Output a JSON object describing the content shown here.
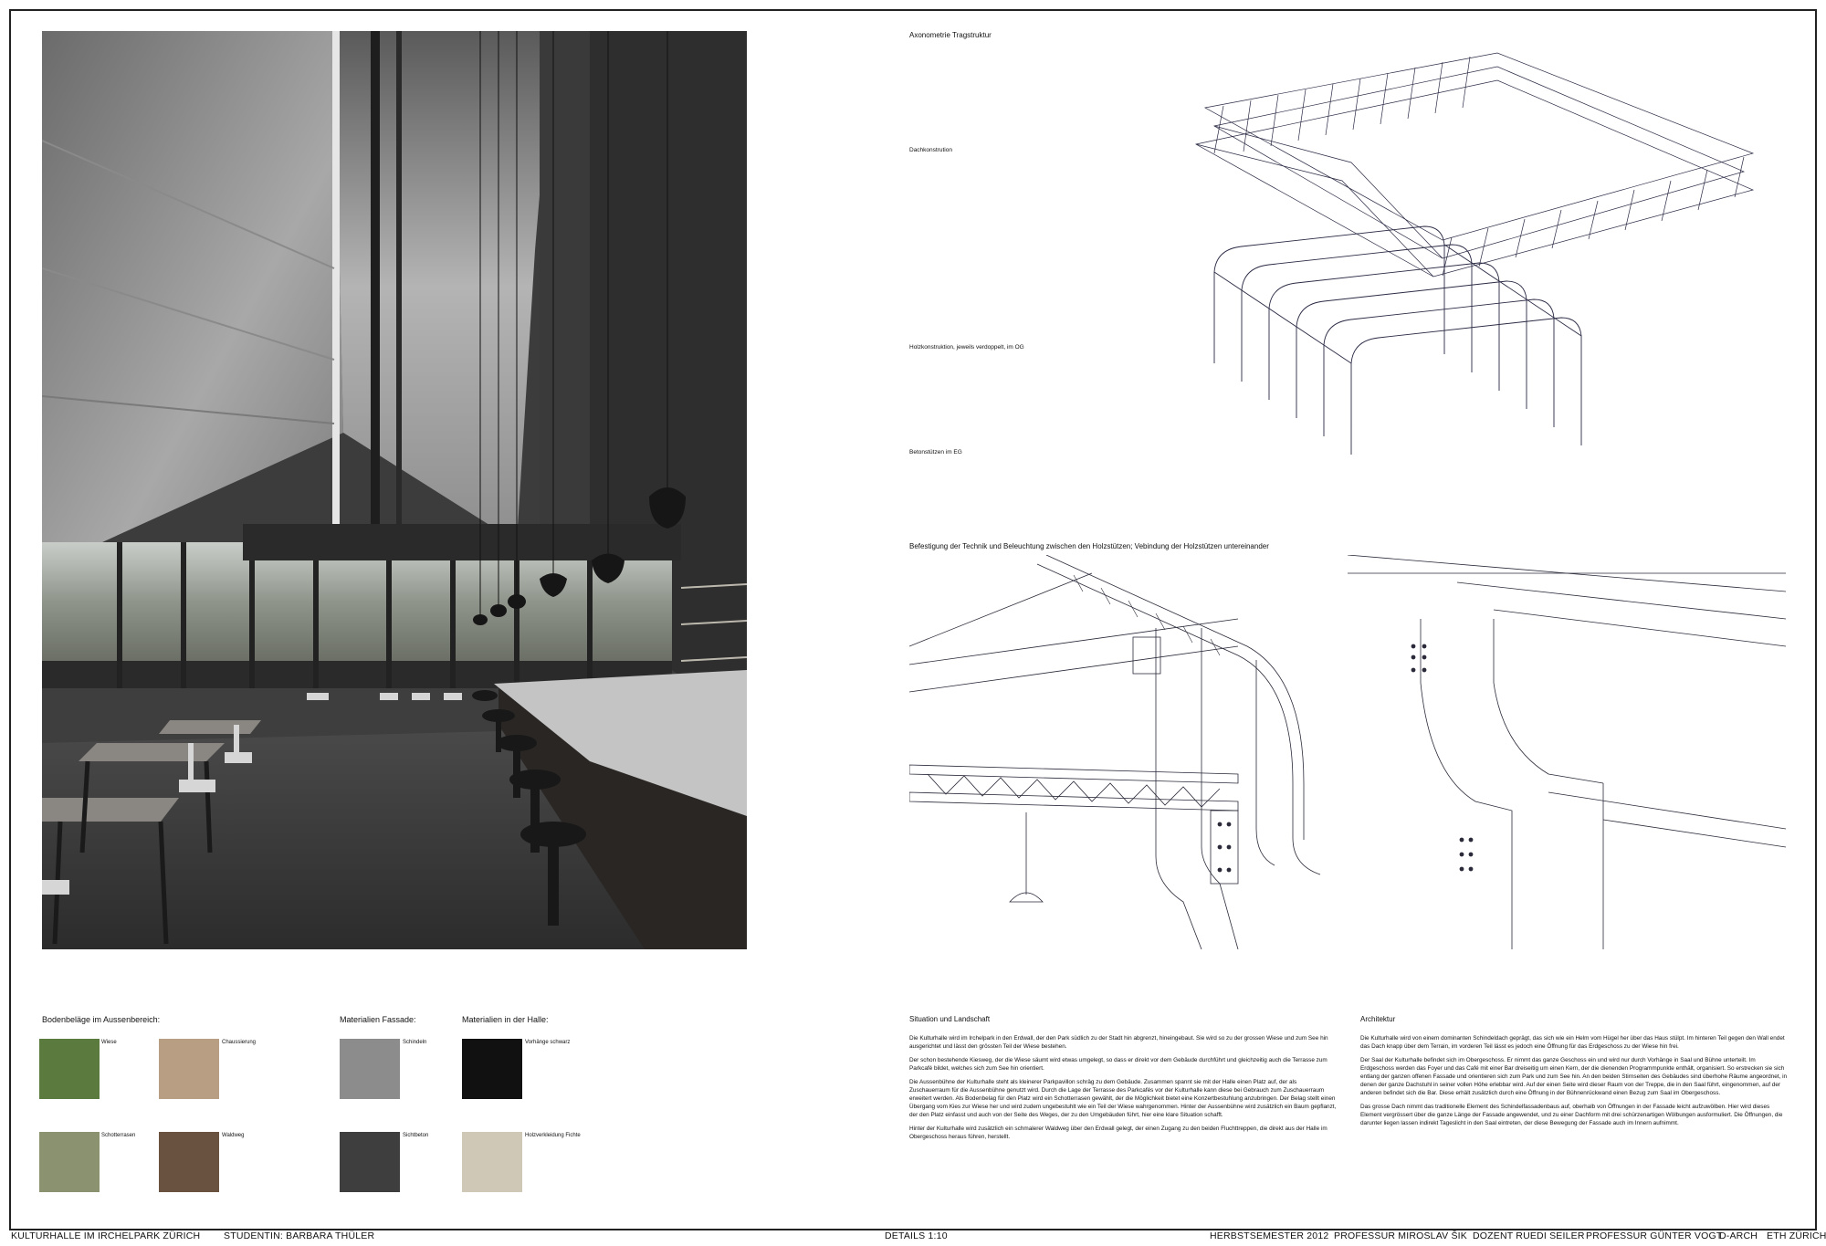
{
  "materials": {
    "outdoor_heading": "Bodenbeläge im Aussenbereich:",
    "facade_heading": "Materialien Fassade:",
    "hall_heading": "Materialien in der Halle:",
    "items": [
      {
        "label": "Wiese",
        "color": "#5a7a3e"
      },
      {
        "label": "Chaussierung",
        "color": "#b89f84"
      },
      {
        "label": "Schotterrasen",
        "color": "#8a9270"
      },
      {
        "label": "Waldweg",
        "color": "#6a5240"
      },
      {
        "label": "Schindeln",
        "color": "#8c8c8c"
      },
      {
        "label": "Sichtbeton",
        "color": "#3e3e3e"
      },
      {
        "label": "Vorhänge schwarz",
        "color": "#111111"
      },
      {
        "label": "Holzverkleidung Fichte",
        "color": "#cfc8b6"
      }
    ]
  },
  "axonometry": {
    "title": "Axonometrie Tragstruktur",
    "layers": [
      "Dachkonstrution",
      "Holzkonstruktion, jeweils verdoppelt, im OG",
      "Betonstützen im EG"
    ]
  },
  "detail": {
    "title": "Befestigung der Technik und Beleuchtung zwischen den Holzstützen; Vebindung der Holzstützen untereinander"
  },
  "situation": {
    "title": "Situation und Landschaft",
    "paragraphs": [
      "Die Kulturhalle wird im Irchelpark in den Erdwall, der den Park südlich zu der Stadt hin abgrenzt, hineingebaut. Sie wird so zu der grossen Wiese und zum See hin ausgerichtet und lässt den grössten Teil der Wiese bestehen.",
      "Der schon bestehende Kiesweg, der die Wiese säumt wird etwas umgelegt, so dass er direkt vor dem Gebäude durchführt und gleichzeitig auch die Terrasse zum Parkcafé bildet, welches sich zum See hin orientiert.",
      "Die Aussenbühne der Kulturhalle steht als kleinerer Parkpavillon schräg zu dem Gebäude. Zusammen spannt sie mit der Halle einen Platz auf, der als Zuschauerraum für die Aussenbühne genutzt wird. Durch die Lage der Terrasse des Parkcafés vor der Kulturhalle kann diese bei Gebrauch zum Zuschauerraum erweitert werden. Als Bodenbelag für den Platz wird ein Schotterrasen gewählt, der die Möglichkeit bietet eine Konzertbestuhlung anzubringen. Der Belag stellt einen Übergang vom Kies zur Wiese her und wird zudem ungebestuhlt wie ein Teil der Wiese wahrgenommen. Hinter der Aussenbühne wird zusätzlich ein Baum gepflanzt, der den Platz einfasst und auch von der Seite des Weges, der zu den Umgebäuden führt, hier eine klare Situation schafft.",
      "Hinter der Kulturhalle wird zusätzlich ein schmalerer Waldweg über den Erdwall gelegt, der einen Zugang zu den beiden Fluchttreppen, die direkt aus der Halle im Obergeschoss heraus führen, herstellt."
    ]
  },
  "architektur": {
    "title": "Architektur",
    "paragraphs": [
      "Die Kulturhalle wird von einem dominanten Schindeldach geprägt, das sich wie ein Helm vom Hügel her über das Haus stülpt. Im hinteren Teil gegen den Wall endet das Dach knapp über dem Terrain, im vorderen Teil lässt es jedoch eine Öffnung für das Erdgeschoss zu der Wiese hin frei.",
      "Der Saal der Kulturhalle befindet sich im Obergeschoss. Er nimmt das ganze Geschoss ein und wird nur durch Vorhänge in Saal und Bühne unterteilt. Im Erdgeschoss werden das Foyer und das Café mit einer Bar dreiseitig um einen Kern, der die dienenden Programmpunkte enthält, organisiert. So erstrecken sie sich entlang der ganzen offenen Fassade und orientieren sich zum Park und zum See hin. An den beiden Stirnseiten des Gebäudes sind überhohe Räume angeordnet, in denen der ganze Dachstuhl in seiner vollen Höhe erlebbar wird. Auf der einen Seite wird dieser Raum von der Treppe, die in den Saal führt, eingenommen, auf der anderen befindet sich die Bar. Diese erhält zusätzlich durch eine Öffnung in der Bühnenrückwand einen Bezug zum Saal im Obergeschoss.",
      "Das grosse Dach nimmt das traditionelle Element des Schindelfassadenbaus auf, oberhalb von Öffnungen in der Fassade leicht aufzuwölben. Hier wird dieses Element vergrössert über die ganze Länge der Fassade angewendet, und zu einer Dachform mit drei schürzenartigen Wölbungen ausformuliert. Die Öffnungen, die darunter liegen lassen indirekt Tageslicht in den Saal eintreten, der diese Bewegung der Fassade auch im Innern aufnimmt."
    ]
  },
  "footer": {
    "project": "KULTURHALLE IM IRCHELPARK ZÜRICH",
    "student": "STUDENTIN: BARBARA THÜLER",
    "scale": "DETAILS 1:10",
    "semester": "HERBSTSEMESTER 2012",
    "professor1": "PROFESSUR MIROSLAV ŠIK",
    "dozent": "DOZENT RUEDI SEILER",
    "professor2": "PROFESSUR GÜNTER VOGT",
    "dept": "D-ARCH",
    "school": "ETH ZÜRICH"
  }
}
